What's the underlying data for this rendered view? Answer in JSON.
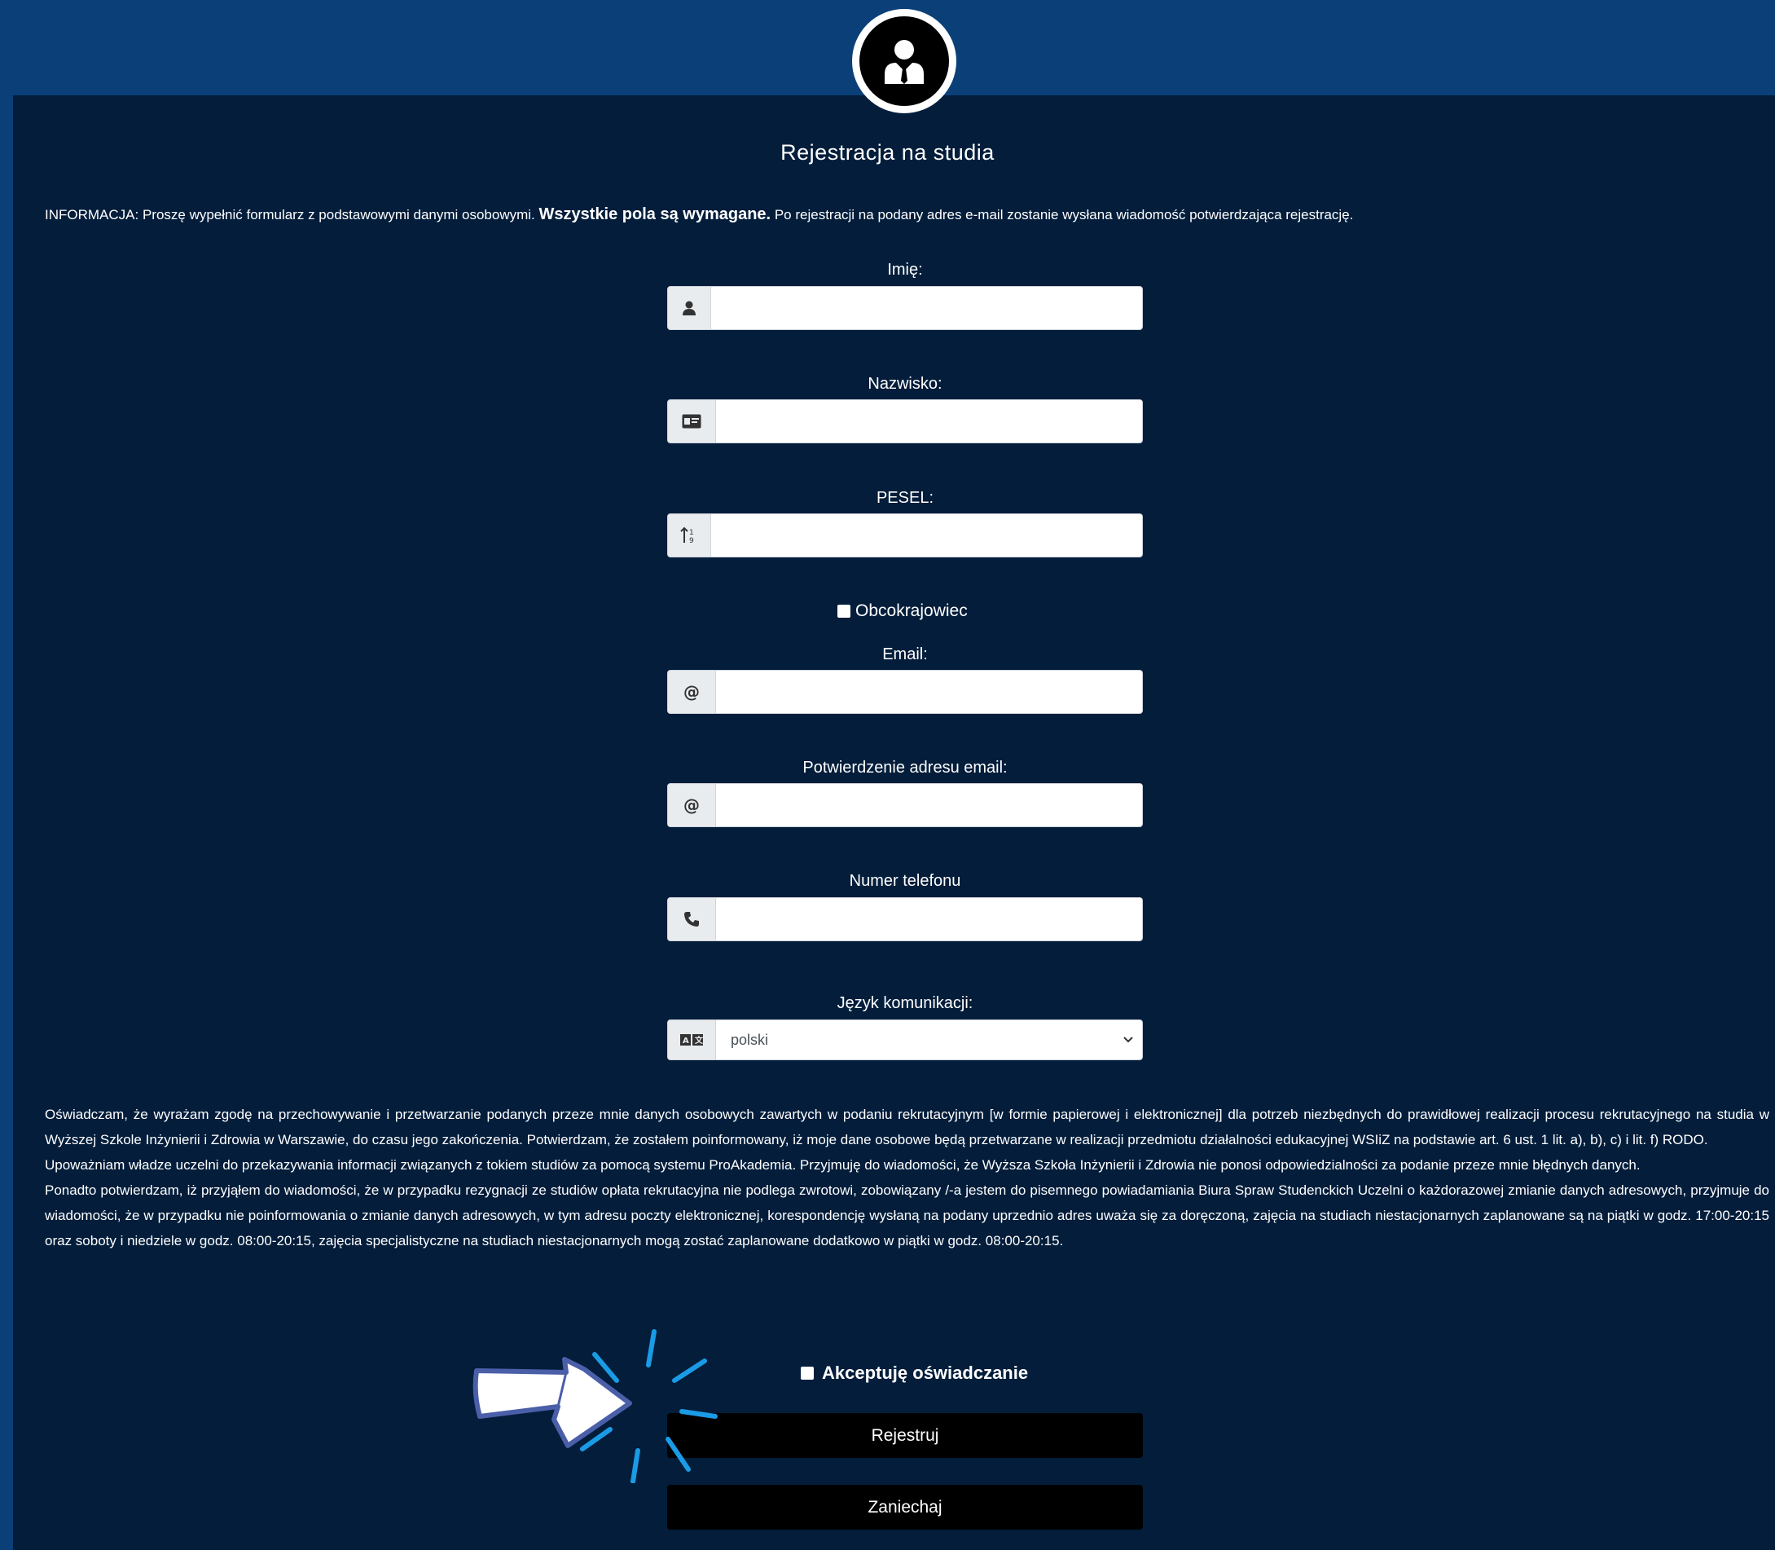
{
  "header": {
    "title": "Rejestracja na studia"
  },
  "info": {
    "prefix": "INFORMACJA: Proszę wypełnić formularz z podstawowymi danymi osobowymi.",
    "bold": "Wszystkie pola są wymagane.",
    "suffix": "Po rejestracji na podany adres e-mail zostanie wysłana wiadomość potwierdzająca rejestrację."
  },
  "form": {
    "first_name": {
      "label": "Imię:",
      "value": "",
      "icon": "user-icon"
    },
    "last_name": {
      "label": "Nazwisko:",
      "value": "",
      "icon": "id-card-icon"
    },
    "pesel": {
      "label": "PESEL:",
      "value": "",
      "icon": "sort-numeric-icon"
    },
    "foreigner": {
      "label": "Obcokrajowiec",
      "checked": false
    },
    "email": {
      "label": "Email:",
      "value": "",
      "icon": "at-icon"
    },
    "email_confirm": {
      "label": "Potwierdzenie adresu email:",
      "value": "",
      "icon": "at-icon"
    },
    "phone": {
      "label": "Numer telefonu",
      "value": "",
      "icon": "phone-icon"
    },
    "language": {
      "label": "Język komunikacji:",
      "selected": "polski",
      "icon": "language-icon"
    }
  },
  "consent": {
    "p1": "Oświadczam, że wyrażam zgodę na przechowywanie i przetwarzanie podanych przeze mnie danych osobowych zawartych w podaniu rekrutacyjnym [w formie papierowej i elektronicznej] dla potrzeb niezbędnych do prawidłowej realizacji procesu rekrutacyjnego na studia w Wyższej Szkole Inżynierii i Zdrowia w Warszawie, do czasu jego zakończenia. Potwierdzam, że zostałem poinformowany, iż moje dane osobowe będą przetwarzane w realizacji przedmiotu działalności edukacyjnej WSIiZ na podstawie art. 6 ust. 1 lit. a), b), c) i lit. f) RODO.",
    "p2": "Upoważniam władze uczelni do przekazywania informacji związanych z tokiem studiów za pomocą systemu ProAkademia. Przyjmuję do wiadomości, że Wyższa Szkoła Inżynierii i Zdrowia nie ponosi odpowiedzialności za podanie przeze mnie błędnych danych.",
    "p3": "Ponadto potwierdzam, iż przyjąłem do wiadomości, że w przypadku rezygnacji ze studiów opłata rekrutacyjna nie podlega zwrotowi, zobowiązany /-a jestem do pisemnego powiadamiania Biura Spraw Studenckich Uczelni o każdorazowej zmianie danych adresowych, przyjmuje do wiadomości, że w przypadku nie poinformowania o zmianie danych adresowych, w tym adresu poczty elektronicznej, korespondencję wysłaną na podany uprzednio adres uważa się za doręczoną, zajęcia na studiach niestacjonarnych zaplanowane są na piątki w godz. 17:00-20:15 oraz soboty i niedziele w godz. 08:00-20:15, zajęcia specjalistyczne na studiach niestacjonarnych mogą zostać zaplanowane dodatkowo w piątki w godz. 08:00-20:15.",
    "accept_label": "Akceptuję oświadczanie",
    "accepted": false
  },
  "buttons": {
    "register": "Rejestruj",
    "cancel": "Zaniechaj"
  },
  "colors": {
    "header_bg": "#0b3f77",
    "panel_bg": "#031d3b",
    "button_bg": "#000000",
    "pointer_accent": "#1a9be6"
  }
}
